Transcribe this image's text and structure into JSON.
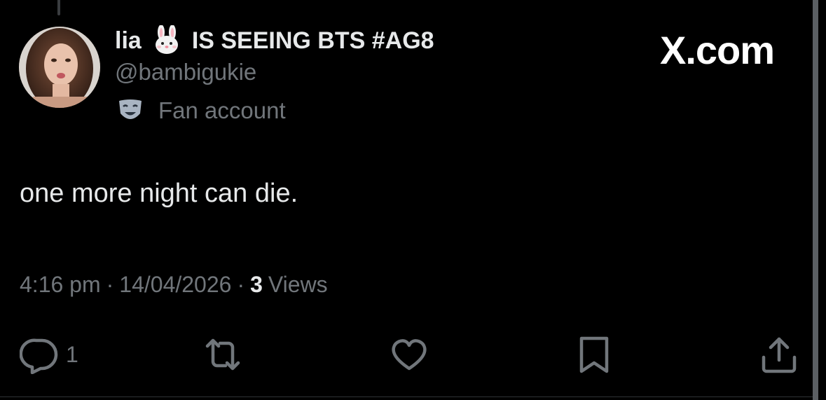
{
  "author": {
    "display_name_prefix": "lia",
    "display_name_suffix": "IS SEEING BTS #AG8",
    "handle": "@bambigukie",
    "label": "Fan account",
    "name_emoji": "rabbit-face-icon",
    "label_icon": "performing-arts-mask-icon"
  },
  "brand": {
    "text": "X.com"
  },
  "tweet": {
    "text": "one more night can die.",
    "time": "4:16 pm",
    "date": "14/04/2026",
    "views_count": "3",
    "views_label": "Views",
    "separator": "·"
  },
  "actions": {
    "reply_count": "1"
  },
  "colors": {
    "background": "#000000",
    "primary_text": "#e7e9ea",
    "secondary_text": "#71767b"
  }
}
